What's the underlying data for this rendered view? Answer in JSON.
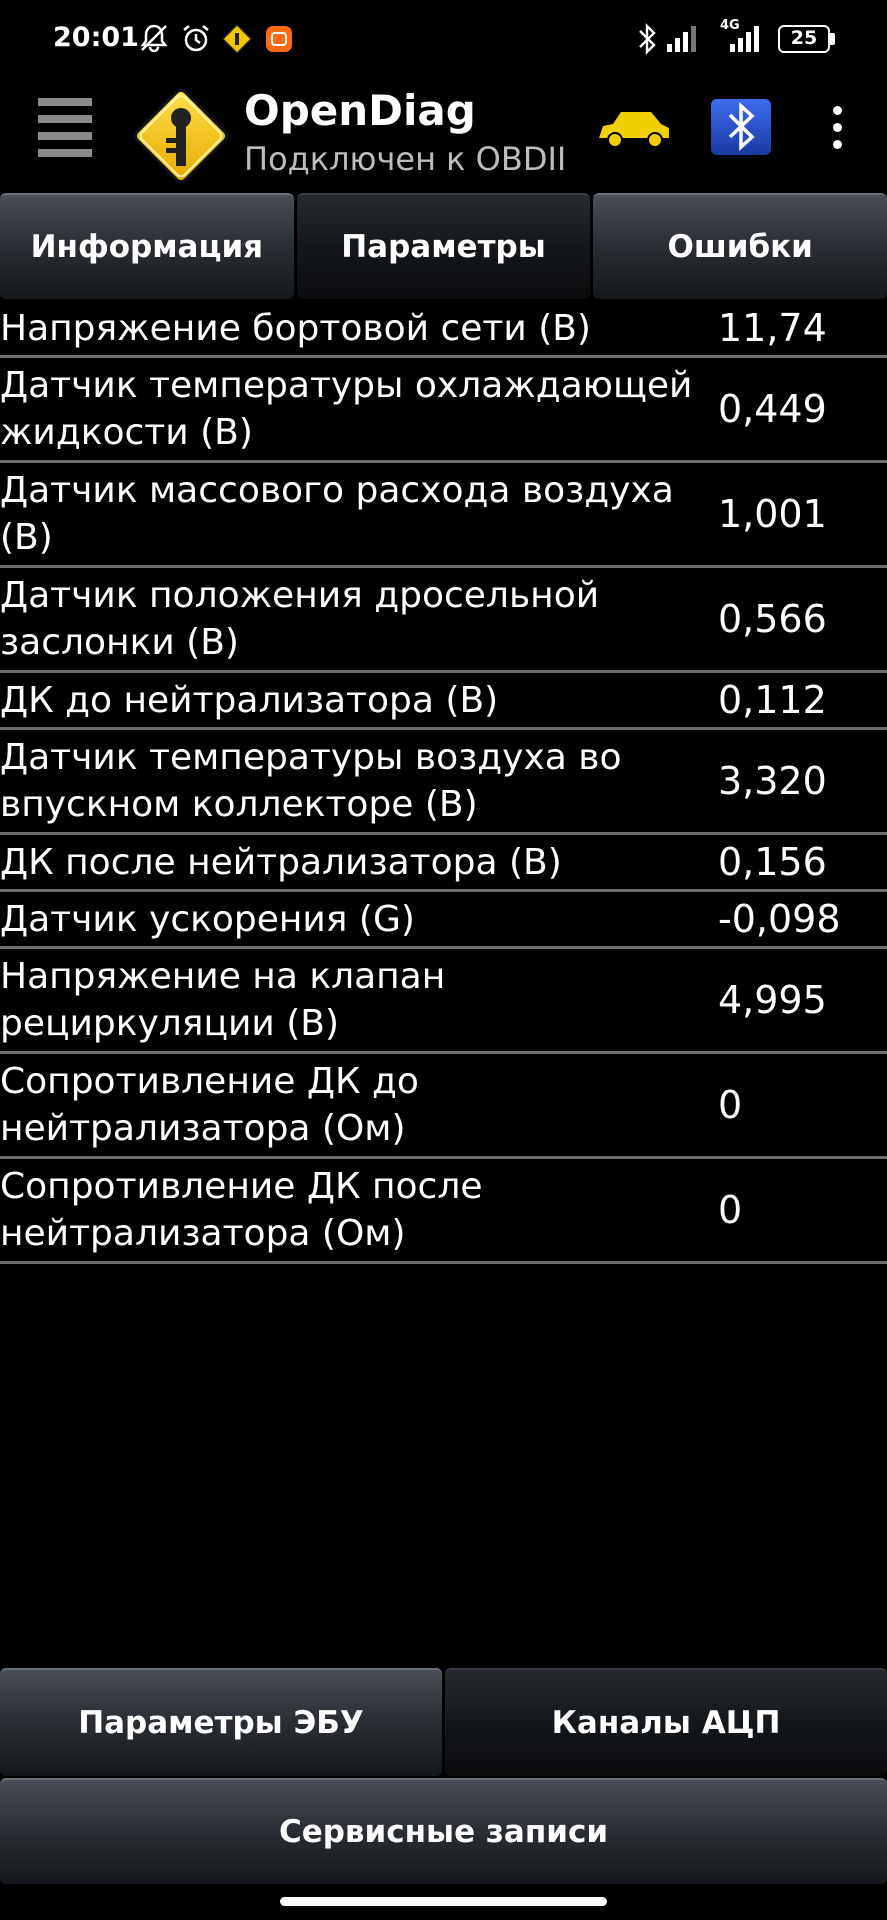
{
  "status_bar": {
    "time": "20:01",
    "network_label": "4G",
    "battery": "25",
    "icons": [
      "mute-icon",
      "alarm-icon",
      "opendiag-notif-icon",
      "mi-notif-icon",
      "bluetooth-icon",
      "signal-icon",
      "signal-4g-icon",
      "battery-icon"
    ]
  },
  "toolbar": {
    "title": "OpenDiag",
    "subtitle": "Подключен к OBDII",
    "icons": [
      "menu-icon",
      "app-logo-icon",
      "car-icon",
      "bluetooth-elm-icon",
      "more-options-icon"
    ]
  },
  "tabs": [
    {
      "label": "Информация",
      "active": false
    },
    {
      "label": "Параметры",
      "active": true
    },
    {
      "label": "Ошибки",
      "active": false
    }
  ],
  "params": [
    {
      "name": "Напряжение бортовой сети (В)",
      "value": "11,74"
    },
    {
      "name": "Датчик температуры охлаждающей жидкости (В)",
      "value": "0,449"
    },
    {
      "name": "Датчик массового расхода воздуха (В)",
      "value": "1,001"
    },
    {
      "name": "Датчик положения дросельной заслонки (В)",
      "value": "0,566"
    },
    {
      "name": "ДК до нейтрализатора (В)",
      "value": "0,112"
    },
    {
      "name": "Датчик температуры воздуха во впускном коллекторе (В)",
      "value": "3,320"
    },
    {
      "name": "ДК после нейтрализатора (В)",
      "value": "0,156"
    },
    {
      "name": "Датчик ускорения (G)",
      "value": "-0,098"
    },
    {
      "name": "Напряжение на клапан рециркуляции (В)",
      "value": "4,995"
    },
    {
      "name": "Сопротивление ДК до нейтрализатора (Ом)",
      "value": "0"
    },
    {
      "name": "Сопротивление ДК после нейтрализатора (Ом)",
      "value": "0"
    }
  ],
  "bottom_buttons": [
    {
      "label": "Параметры ЭБУ",
      "active": false
    },
    {
      "label": "Каналы АЦП",
      "active": true
    }
  ],
  "service_button": {
    "label": "Сервисные записи"
  },
  "colors": {
    "background": "#000000",
    "divider": "#6e6e6e",
    "car_yellow": "#f2d000",
    "logo_yellow": "#f5c400",
    "bt_blue": "#2a52c9"
  }
}
